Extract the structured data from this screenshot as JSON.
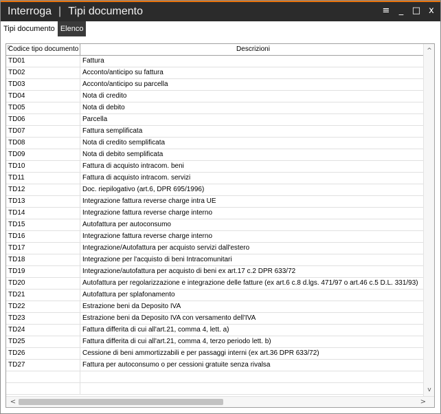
{
  "window": {
    "title_app": "Interroga",
    "title_separator": "|",
    "title_page": "Tipi documento",
    "accent_color": "#e8730c"
  },
  "window_controls": {
    "menu_icon": "≡",
    "minimize_icon": "_",
    "maximize_icon": "□",
    "close_icon": "x"
  },
  "tabs": [
    {
      "label": "Tipi documento",
      "active": true
    },
    {
      "label": "Elenco",
      "active": false
    }
  ],
  "table": {
    "columns": [
      "Codice tipo documento",
      "Descrizioni"
    ],
    "rows": [
      {
        "code": "TD01",
        "desc": "Fattura"
      },
      {
        "code": "TD02",
        "desc": "Acconto/anticipo su fattura"
      },
      {
        "code": "TD03",
        "desc": "Acconto/anticipo su parcella"
      },
      {
        "code": "TD04",
        "desc": "Nota di credito"
      },
      {
        "code": "TD05",
        "desc": "Nota di debito"
      },
      {
        "code": "TD06",
        "desc": "Parcella"
      },
      {
        "code": "TD07",
        "desc": "Fattura semplificata"
      },
      {
        "code": "TD08",
        "desc": "Nota di credito semplificata"
      },
      {
        "code": "TD09",
        "desc": "Nota di debito semplificata"
      },
      {
        "code": "TD10",
        "desc": "Fattura di acquisto intracom. beni"
      },
      {
        "code": "TD11",
        "desc": "Fattura di acquisto intracom. servizi"
      },
      {
        "code": "TD12",
        "desc": "Doc. riepilogativo (art.6, DPR 695/1996)"
      },
      {
        "code": "TD13",
        "desc": "Integrazione fattura reverse charge intra UE"
      },
      {
        "code": "TD14",
        "desc": "Integrazione fattura reverse charge interno"
      },
      {
        "code": "TD15",
        "desc": "Autofattura per autoconsumo"
      },
      {
        "code": "TD16",
        "desc": "Integrazione fattura reverse charge interno"
      },
      {
        "code": "TD17",
        "desc": "Integrazione/Autofattura per acquisto servizi dall'estero"
      },
      {
        "code": "TD18",
        "desc": "Integrazione per l'acquisto di beni Intracomunitari"
      },
      {
        "code": "TD19",
        "desc": "Integrazione/autofattura per acquisto di beni ex art.17 c.2 DPR 633/72"
      },
      {
        "code": "TD20",
        "desc": "Autofattura per regolarizzazione e integrazione delle fatture (ex art.6 c.8 d.lgs. 471/97  o  art.46 c.5 D.L. 331/93)"
      },
      {
        "code": "TD21",
        "desc": "Autofattura per splafonamento"
      },
      {
        "code": "TD22",
        "desc": "Estrazione beni da Deposito IVA"
      },
      {
        "code": "TD23",
        "desc": "Estrazione beni da Deposito IVA con versamento dell'IVA"
      },
      {
        "code": "TD24",
        "desc": "Fattura differita di cui all'art.21, comma 4, lett. a)"
      },
      {
        "code": "TD25",
        "desc": "Fattura differita di cui all'art.21, comma 4, terzo periodo lett. b)"
      },
      {
        "code": "TD26",
        "desc": "Cessione di beni ammortizzabili e per passaggi interni (ex art.36 DPR 633/72)"
      },
      {
        "code": "TD27",
        "desc": "Fattura per autoconsumo o per cessioni gratuite senza rivalsa"
      }
    ]
  },
  "scrollbars": {
    "up_icon": "^",
    "down_icon": "v",
    "left_icon": "<",
    "right_icon": ">"
  }
}
